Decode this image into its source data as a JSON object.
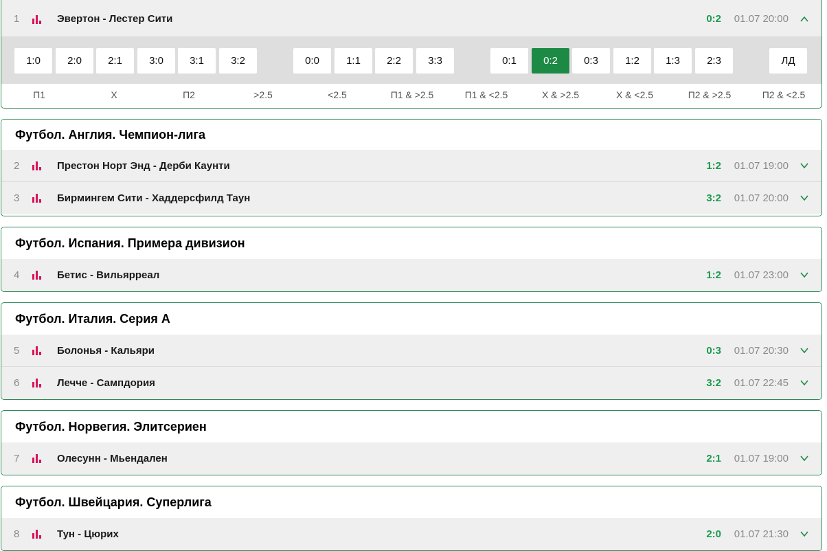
{
  "expanded_match": {
    "num": "1",
    "name": "Эвертон - Лестер Сити",
    "score": "0:2",
    "time": "01.07 20:00"
  },
  "score_options": [
    "1:0",
    "2:0",
    "2:1",
    "3:0",
    "3:1",
    "3:2",
    "0:0",
    "1:1",
    "2:2",
    "3:3",
    "0:1",
    "0:2",
    "0:3",
    "1:2",
    "1:3",
    "2:3",
    "ЛД"
  ],
  "selected_score": "0:2",
  "bet_labels": [
    "П1",
    "Х",
    "П2",
    ">2.5",
    "<2.5",
    "П1 & >2.5",
    "П1 & <2.5",
    "Х & >2.5",
    "Х & <2.5",
    "П2 & >2.5",
    "П2 & <2.5"
  ],
  "leagues": [
    {
      "title": "Футбол. Англия. Чемпион-лига",
      "matches": [
        {
          "num": "2",
          "name": "Престон Норт Энд - Дерби Каунти",
          "score": "1:2",
          "time": "01.07 19:00"
        },
        {
          "num": "3",
          "name": "Бирмингем Сити - Хаддерсфилд Таун",
          "score": "3:2",
          "time": "01.07 20:00"
        }
      ]
    },
    {
      "title": "Футбол. Испания. Примера дивизион",
      "matches": [
        {
          "num": "4",
          "name": "Бетис - Вильярреал",
          "score": "1:2",
          "time": "01.07 23:00"
        }
      ]
    },
    {
      "title": "Футбол. Италия. Серия А",
      "matches": [
        {
          "num": "5",
          "name": "Болонья - Кальяри",
          "score": "0:3",
          "time": "01.07 20:30"
        },
        {
          "num": "6",
          "name": "Лечче - Сампдория",
          "score": "3:2",
          "time": "01.07 22:45"
        }
      ]
    },
    {
      "title": "Футбол. Норвегия. Элитсериен",
      "matches": [
        {
          "num": "7",
          "name": "Олесунн - Мьендален",
          "score": "2:1",
          "time": "01.07 19:00"
        }
      ]
    },
    {
      "title": "Футбол. Швейцария. Суперлига",
      "matches": [
        {
          "num": "8",
          "name": "Тун - Цюрих",
          "score": "2:0",
          "time": "01.07 21:30"
        }
      ]
    }
  ],
  "icons": {
    "stats": "bar-chart-icon",
    "collapse": "chevron-up-icon",
    "expand": "chevron-down-icon"
  },
  "colors": {
    "accent_green": "#1c8a45",
    "score_green": "#1c9b4e",
    "stats_pink": "#d8135b",
    "border_green": "#2e8b57"
  }
}
